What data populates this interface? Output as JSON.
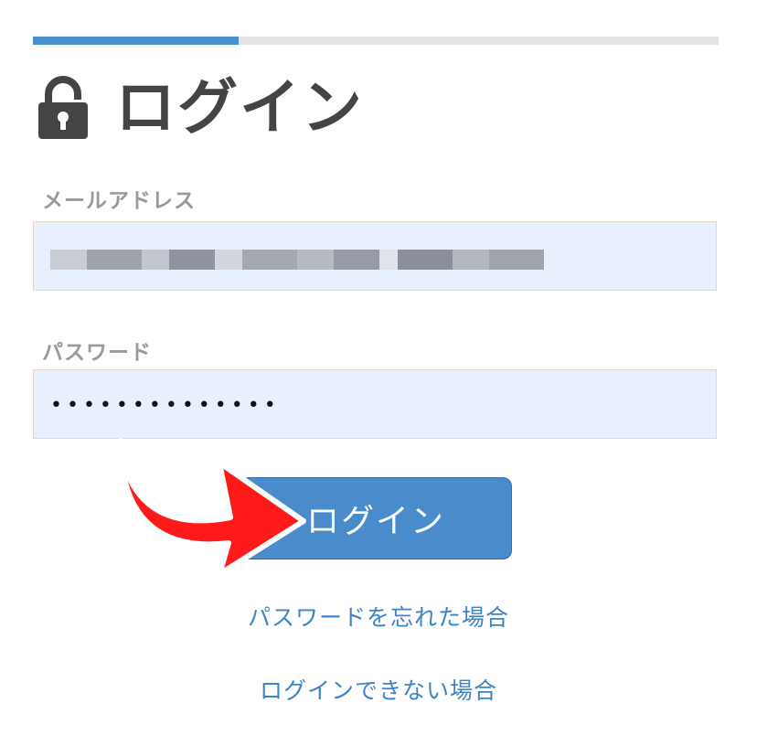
{
  "progress": {
    "value": 0.3,
    "fill_color": "#4a8fd0",
    "track_color": "#e3e3e3"
  },
  "header": {
    "title": "ログイン",
    "icon": "lock-icon"
  },
  "email": {
    "label": "メールアドレス",
    "value_redacted": true
  },
  "password": {
    "label": "パスワード",
    "masked_value": "••••••••••••••"
  },
  "login_button": {
    "label": "ログイン",
    "color": "#4a8bcb"
  },
  "annotation": {
    "icon": "red-arrow-icon",
    "color": "#ff1a1a"
  },
  "links": {
    "forgot_password": "パスワードを忘れた場合",
    "cannot_login": "ログインできない場合"
  }
}
